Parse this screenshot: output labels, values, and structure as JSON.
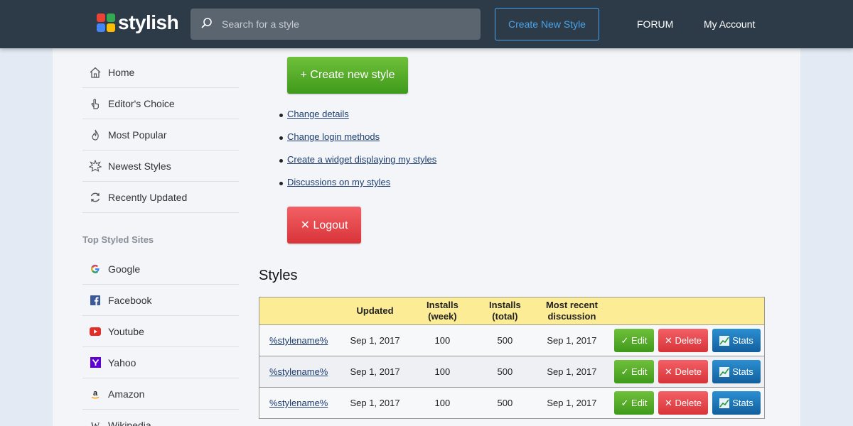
{
  "header": {
    "logo_text": "stylish",
    "search_placeholder": "Search for a style",
    "create_new_style": "Create New Style",
    "forum": "FORUM",
    "my_account": "My Account"
  },
  "sidebar": {
    "items": [
      {
        "label": "Home",
        "icon": "home-icon"
      },
      {
        "label": "Editor's Choice",
        "icon": "hand-pointer-icon"
      },
      {
        "label": "Most Popular",
        "icon": "flame-icon"
      },
      {
        "label": "Newest Styles",
        "icon": "sparkle-icon"
      },
      {
        "label": "Recently Updated",
        "icon": "refresh-icon"
      }
    ],
    "top_sites_heading": "Top Styled Sites",
    "sites": [
      {
        "label": "Google",
        "icon": "google-icon"
      },
      {
        "label": "Facebook",
        "icon": "facebook-icon"
      },
      {
        "label": "Youtube",
        "icon": "youtube-icon"
      },
      {
        "label": "Yahoo",
        "icon": "yahoo-icon"
      },
      {
        "label": "Amazon",
        "icon": "amazon-icon"
      },
      {
        "label": "Wikipedia",
        "icon": "wikipedia-icon"
      }
    ]
  },
  "main": {
    "create_button": "+ Create new style",
    "links": [
      "Change details",
      "Change login methods",
      "Create a widget displaying my styles",
      "Discussions on my styles"
    ],
    "logout_button": "✕ Logout",
    "styles_heading": "Styles"
  },
  "table": {
    "headers": {
      "updated": "Updated",
      "installs_week": [
        "Installs",
        "(week)"
      ],
      "installs_total": [
        "Installs",
        "(total)"
      ],
      "recent": [
        "Most recent",
        "discussion"
      ]
    },
    "rows": [
      {
        "name": "%stylename%",
        "updated": "Sep 1, 2017",
        "week": "100",
        "total": "500",
        "recent": "Sep 1, 2017"
      },
      {
        "name": "%stylename%",
        "updated": "Sep 1, 2017",
        "week": "100",
        "total": "500",
        "recent": "Sep 1, 2017"
      },
      {
        "name": "%stylename%",
        "updated": "Sep 1, 2017",
        "week": "100",
        "total": "500",
        "recent": "Sep 1, 2017"
      }
    ],
    "edit_label": "✓ Edit",
    "delete_label": "✕ Delete",
    "stats_label": "Stats"
  },
  "colors": {
    "header_bg": "#2d3b48",
    "accent_blue": "#4aa3e8",
    "green": "#4fa82a",
    "red": "#e0474c",
    "table_header": "#fdec96"
  }
}
